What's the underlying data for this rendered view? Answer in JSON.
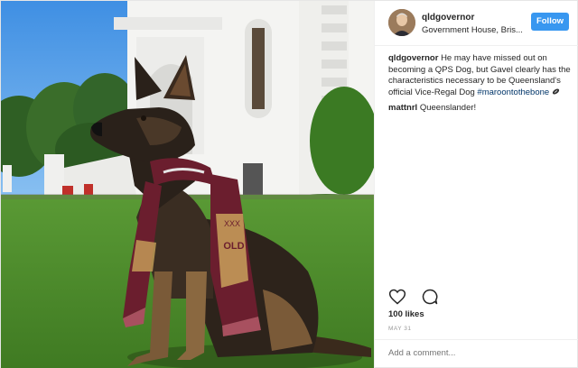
{
  "post": {
    "username": "qldgovernor",
    "location": "Government House, Bris...",
    "follow_label": "Follow",
    "caption_user": "qldgovernor",
    "caption_text": "He may have missed out on becoming a QPS Dog, but Gavel clearly has the characteristics necessary to be Queensland's official Vice-Regal Dog",
    "caption_hashtag": "#maroontothebone",
    "comments": [
      {
        "user": "mattnrl",
        "text": "Queenslander!"
      }
    ],
    "likes": "100 likes",
    "date": "MAY 31",
    "comment_placeholder": "Add a comment..."
  },
  "icons": {
    "like": "heart-icon",
    "comment": "comment-bubble-icon",
    "caption_emoji": "football-icon"
  },
  "colors": {
    "follow_button": "#3897f0",
    "hashtag": "#003569",
    "scarf_maroon": "#6b1e2e",
    "sky": "#4f9de8",
    "grass": "#4f8f2e"
  }
}
